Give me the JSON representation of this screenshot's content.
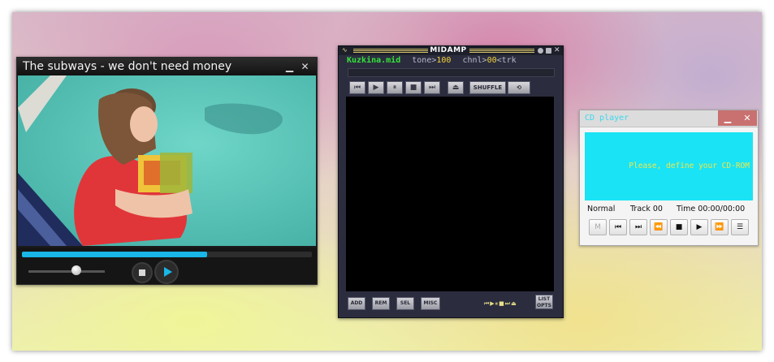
{
  "video_player": {
    "title": "The subways - we don't need money",
    "minimize_glyph": "▁",
    "close_glyph": "✕",
    "progress_fraction": 0.64,
    "volume_fraction": 0.63,
    "accent_color": "#19b6e8"
  },
  "midamp": {
    "app_name": "MIDAMP",
    "logo_glyph": "∿",
    "filename": "Kuzkina.mid",
    "tone_label": "tone>",
    "tone_value": "100",
    "chnl_label": "chnl>",
    "chnl_value": "00",
    "trk_label": "<trk",
    "transport": [
      {
        "icon": "prev-icon",
        "glyph": "⏮"
      },
      {
        "icon": "play-icon",
        "glyph": "▶"
      },
      {
        "icon": "pause-icon",
        "glyph": "⏸"
      },
      {
        "icon": "stop-icon",
        "glyph": "■"
      },
      {
        "icon": "next-icon",
        "glyph": "⏭"
      },
      {
        "icon": "eject-icon",
        "glyph": "⏏"
      }
    ],
    "shuffle_label": "SHUFFLE",
    "repeat_label": "⟲",
    "playlist_buttons": [
      "ADD",
      "REM",
      "SEL",
      "MISC"
    ],
    "mini_controls": "⏮▶⏸■⏭⏏",
    "list_opts_line1": "LIST",
    "list_opts_line2": "OPTS"
  },
  "cd_player": {
    "title": "CD player",
    "minimize_glyph": "▁",
    "close_glyph": "✕",
    "message": "Please, define your CD-ROM",
    "mode": "Normal",
    "track_label": "Track 00",
    "time_label": "Time 00:00/00:00",
    "buttons": [
      {
        "icon": "mode-icon",
        "glyph": "M"
      },
      {
        "icon": "prev-track-icon",
        "glyph": "⏮"
      },
      {
        "icon": "next-track-icon",
        "glyph": "⏭"
      },
      {
        "icon": "rewind-icon",
        "glyph": "⏪"
      },
      {
        "icon": "stop-icon",
        "glyph": "■"
      },
      {
        "icon": "play-icon",
        "glyph": "▶"
      },
      {
        "icon": "fast-forward-icon",
        "glyph": "⏩"
      },
      {
        "icon": "playlist-icon",
        "glyph": "☰"
      }
    ],
    "display_color": "#19e3f4",
    "message_color": "#f0e84a"
  }
}
